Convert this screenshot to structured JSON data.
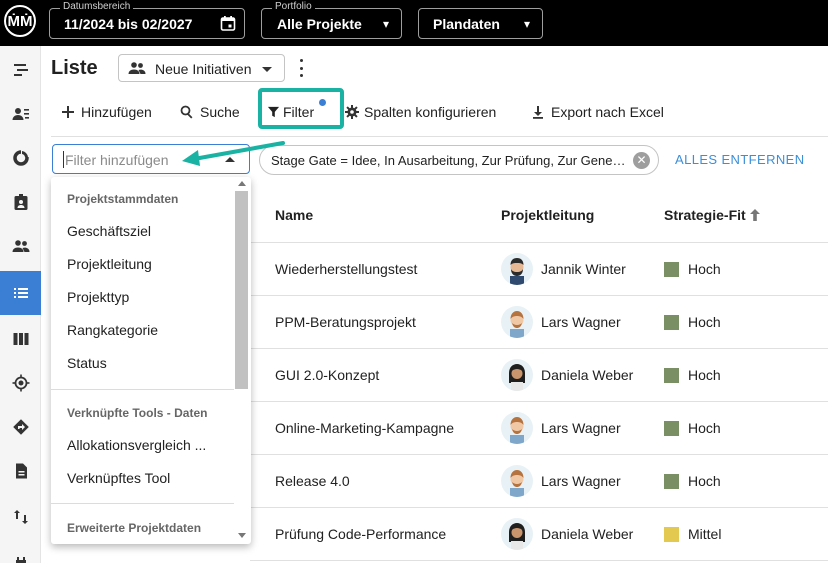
{
  "topbar": {
    "logo": "ṀṀ",
    "date_range": {
      "label": "Datumsbereich",
      "value": "11/2024 bis 02/2027",
      "icon": "calendar-icon"
    },
    "portfolio": {
      "label": "Portfolio",
      "value": "Alle Projekte",
      "icon": "chevron-down-icon"
    },
    "plandata": {
      "value": "Plandaten",
      "icon": "chevron-down-icon"
    }
  },
  "sidebar": {
    "active_color": "#3b7fd4",
    "items": [
      {
        "icon": "gantt-icon"
      },
      {
        "icon": "person-list-icon"
      },
      {
        "icon": "donut-chart-icon"
      },
      {
        "icon": "badge-icon"
      },
      {
        "icon": "people-icon"
      },
      {
        "icon": "list-icon",
        "active": true
      },
      {
        "icon": "columns-icon"
      },
      {
        "icon": "target-icon"
      },
      {
        "icon": "directions-icon"
      },
      {
        "icon": "document-icon"
      },
      {
        "icon": "swap-vert-icon"
      },
      {
        "icon": "accessibility-icon"
      }
    ]
  },
  "header": {
    "title": "Liste",
    "view_select": "Neue Initiativen"
  },
  "toolbar": {
    "add": "Hinzufügen",
    "search": "Suche",
    "filter": "Filter",
    "columns": "Spalten konfigurieren",
    "export": "Export nach Excel"
  },
  "filter_bar": {
    "placeholder": "Filter hinzufügen",
    "chip": "Stage Gate = Idee, In Ausarbeitung, Zur Prüfung, Zur Genehmigung",
    "remove_all": "ALLES ENTFERNEN"
  },
  "dropdown": {
    "groups": [
      {
        "title": "Projektstammdaten",
        "items": [
          "Geschäftsziel",
          "Projektleitung",
          "Projekttyp",
          "Rangkategorie",
          "Status"
        ]
      },
      {
        "title": "Verknüpfte Tools - Daten",
        "items": [
          "Allokationsvergleich ...",
          "Verknüpftes Tool"
        ]
      },
      {
        "title": "Erweiterte Projektdaten",
        "items": []
      }
    ]
  },
  "table": {
    "columns": [
      "Name",
      "Projektleitung",
      "Strategie-Fit"
    ],
    "rows": [
      {
        "name": "Wiederherstellungstest",
        "lead": "Jannik Winter",
        "fit": "Hoch",
        "fit_color": "#7a8f63"
      },
      {
        "name": "PPM-Beratungsprojekt",
        "lead": "Lars Wagner",
        "fit": "Hoch",
        "fit_color": "#7a8f63"
      },
      {
        "name": "GUI 2.0-Konzept",
        "lead": "Daniela Weber",
        "fit": "Hoch",
        "fit_color": "#7a8f63"
      },
      {
        "name": "Online-Marketing-Kampagne",
        "lead": "Lars Wagner",
        "fit": "Hoch",
        "fit_color": "#7a8f63"
      },
      {
        "name": "Release 4.0",
        "lead": "Lars Wagner",
        "fit": "Hoch",
        "fit_color": "#7a8f63"
      },
      {
        "name": "Prüfung Code-Performance",
        "lead": "Daniela Weber",
        "fit": "Mittel",
        "fit_color": "#e3c94f"
      }
    ]
  },
  "annotation": {
    "highlight_color": "#1ab3a3"
  }
}
